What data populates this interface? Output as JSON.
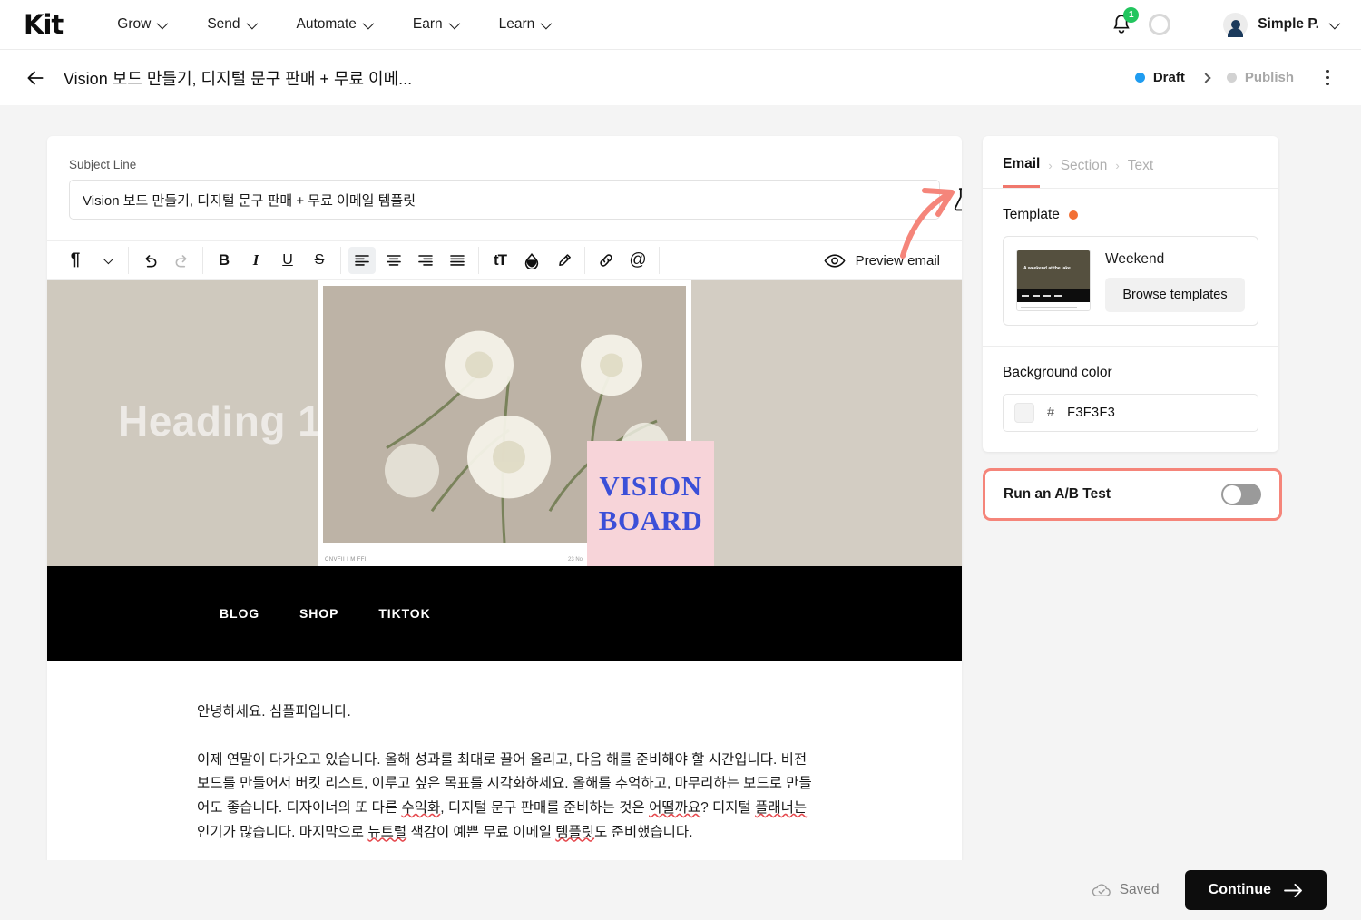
{
  "topnav": {
    "logo": "Kit",
    "items": [
      {
        "label": "Grow"
      },
      {
        "label": "Send"
      },
      {
        "label": "Automate"
      },
      {
        "label": "Earn"
      },
      {
        "label": "Learn"
      }
    ],
    "notification_count": "1",
    "user_name": "Simple P."
  },
  "subheader": {
    "title": "Vision 보드 만들기, 디지털 문구 판매 + 무료 이메...",
    "stage_current": "Draft",
    "stage_next": "Publish"
  },
  "editor": {
    "subject_label": "Subject Line",
    "subject_value": "Vision 보드 만들기, 디지털 문구 판매 + 무료 이메일 템플릿",
    "subject_placeholder": "Subject Line",
    "preview_label": "Preview email",
    "toolbar": {
      "paragraph": "¶",
      "undo": "undo-icon",
      "redo": "redo-icon",
      "bold": "B",
      "italic": "I",
      "underline": "U",
      "strike": "S",
      "align_left": "align-left-icon",
      "align_center": "align-center-icon",
      "align_right": "align-right-icon",
      "align_justify": "align-justify-icon",
      "font_size": "tT",
      "color": "color-drop-icon",
      "highlight": "highlighter-icon",
      "link": "link-icon",
      "mention": "@"
    }
  },
  "email": {
    "heading_placeholder": "Heading 1",
    "vision_board_line1": "VISION",
    "vision_board_line2": "BOARD",
    "photo_caption_left": "CNVFII I M FFI",
    "photo_caption_right": "23 No",
    "nav_links": [
      "BLOG",
      "SHOP",
      "TIKTOK"
    ],
    "paragraphs": [
      "안녕하세요. 심플피입니다.",
      "이제 연말이 다가오고 있습니다. 올해 성과를 최대로 끌어 올리고, 다음 해를 준비해야 할 시간입니다. 비전 보드를 만들어서 버킷 리스트, 이루고 싶은 목표를 시각화하세요. 올해를 추억하고, 마무리하는 보드로 만들어도 좋습니다. 디자이너의 또 다른 수익화, 디지털 문구 판매를 준비하는 것은 어떨까요? 디지털 플래너는 인기가 많습니다. 마지막으로 뉴트럴 색감이 예쁜 무료 이메일 템플릿도 준비했습니다."
    ]
  },
  "sidebar": {
    "breadcrumbs": [
      {
        "label": "Email",
        "active": true
      },
      {
        "label": "Section",
        "active": false
      },
      {
        "label": "Text",
        "active": false
      }
    ],
    "template_label": "Template",
    "template_name": "Weekend",
    "template_thumb_text": "A weekend at the lake",
    "browse_label": "Browse templates",
    "background_label": "Background color",
    "background_hash": "#",
    "background_hex": "F3F3F3",
    "ab_test_label": "Run an A/B Test",
    "ab_test_enabled": false
  },
  "footer": {
    "saved_label": "Saved",
    "continue_label": "Continue"
  },
  "colors": {
    "accent_coral": "#f0776c",
    "annotation_arrow": "#f5857a",
    "draft_blue": "#1f9cf0",
    "template_orb": "#f26f34",
    "badge_green": "#22c55e",
    "vision_board_blue": "#3b4fd8",
    "vision_board_pink": "#f7d4d9"
  }
}
